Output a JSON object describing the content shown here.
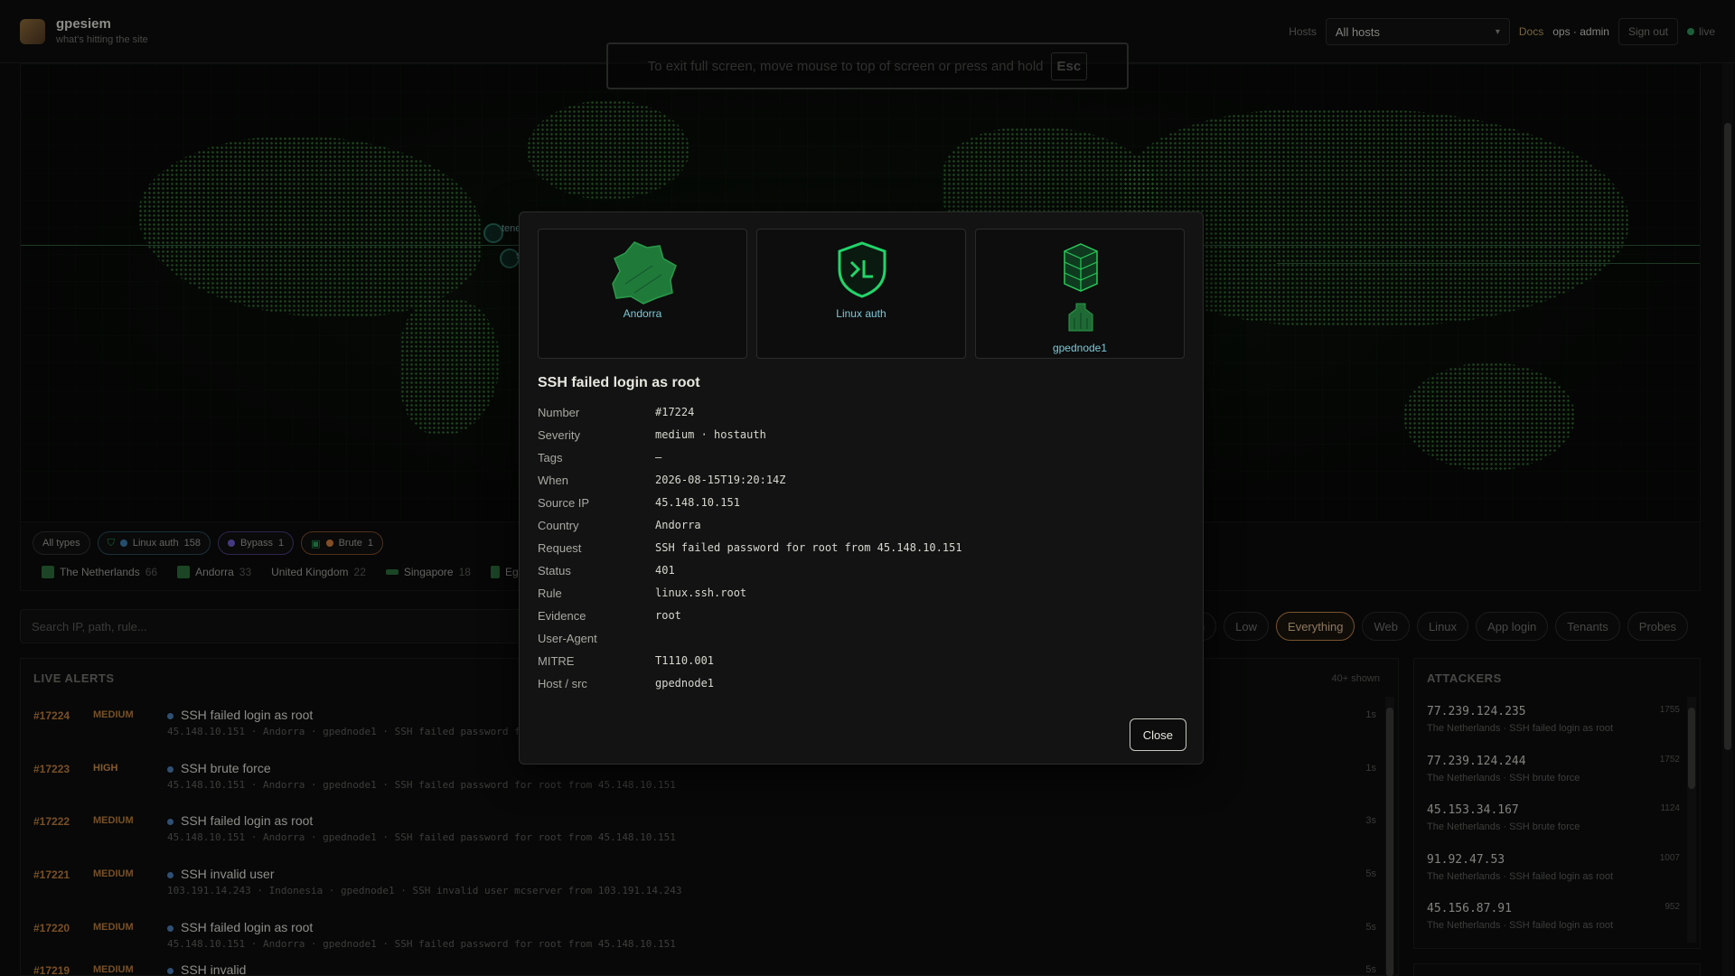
{
  "header": {
    "app_title": "gpesiem",
    "app_subtitle": "what's hitting the site",
    "hosts_label": "Hosts",
    "hosts_selected": "All hosts",
    "docs_link": "Docs",
    "user": "ops · admin",
    "signout_label": "Sign out",
    "live_label": "live"
  },
  "fullscreen_toast": {
    "text": "To exit full screen, move mouse to top of screen or press and hold",
    "key": "Esc"
  },
  "map": {
    "markers": [
      {
        "label": "tene"
      },
      {
        "label": "s"
      }
    ]
  },
  "type_chips": [
    {
      "label": "All types",
      "count": ""
    },
    {
      "label": "Linux auth",
      "count": "158",
      "color": "#3a78a8"
    },
    {
      "label": "Bypass",
      "count": "1",
      "color": "#6a58c8"
    },
    {
      "label": "Brute",
      "count": "1",
      "color": "#c8783a"
    }
  ],
  "countries": [
    {
      "name": "The Netherlands",
      "count": "66"
    },
    {
      "name": "Andorra",
      "count": "33"
    },
    {
      "name": "United Kingdom",
      "count": "22"
    },
    {
      "name": "Singapore",
      "count": "18"
    },
    {
      "name": "Egy",
      "count": ""
    }
  ],
  "search": {
    "placeholder": "Search IP, path, rule..."
  },
  "filters": [
    {
      "label": "edium",
      "active": false
    },
    {
      "label": "Low",
      "active": false
    },
    {
      "label": "Everything",
      "active": true
    },
    {
      "label": "Web",
      "active": false
    },
    {
      "label": "Linux",
      "active": false
    },
    {
      "label": "App login",
      "active": false
    },
    {
      "label": "Tenants",
      "active": false
    },
    {
      "label": "Probes",
      "active": false
    }
  ],
  "alerts": {
    "title": "LIVE ALERTS",
    "count_label": "40+ shown",
    "rows": [
      {
        "id": "#17224",
        "severity": "MEDIUM",
        "title": "SSH failed login as root",
        "meta": "45.148.10.151 · Andorra · gpednode1 · SSH failed password for root from 45.148.10.151",
        "time": "1s"
      },
      {
        "id": "#17223",
        "severity": "HIGH",
        "title": "SSH brute force",
        "meta": "45.148.10.151 · Andorra · gpednode1 · SSH failed password for root from 45.148.10.151",
        "time": "1s"
      },
      {
        "id": "#17222",
        "severity": "MEDIUM",
        "title": "SSH failed login as root",
        "meta": "45.148.10.151 · Andorra · gpednode1 · SSH failed password for root from 45.148.10.151",
        "time": "3s"
      },
      {
        "id": "#17221",
        "severity": "MEDIUM",
        "title": "SSH invalid user",
        "meta": "103.191.14.243 · Indonesia · gpednode1 · SSH invalid user mcserver from 103.191.14.243",
        "time": "5s"
      },
      {
        "id": "#17220",
        "severity": "MEDIUM",
        "title": "SSH failed login as root",
        "meta": "45.148.10.151 · Andorra · gpednode1 · SSH failed password for root from 45.148.10.151",
        "time": "5s"
      },
      {
        "id": "#17219",
        "severity": "MEDIUM",
        "title": "SSH invalid",
        "meta": "",
        "time": "5s"
      }
    ]
  },
  "attackers": {
    "title": "ATTACKERS",
    "rows": [
      {
        "ip": "77.239.124.235",
        "count": "1755",
        "desc": "The Netherlands · SSH failed login as root"
      },
      {
        "ip": "77.239.124.244",
        "count": "1752",
        "desc": "The Netherlands · SSH brute force"
      },
      {
        "ip": "45.153.34.167",
        "count": "1124",
        "desc": "The Netherlands · SSH brute force"
      },
      {
        "ip": "91.92.47.53",
        "count": "1007",
        "desc": "The Netherlands · SSH failed login as root"
      },
      {
        "ip": "45.156.87.91",
        "count": "952",
        "desc": "The Netherlands · SSH failed login as root"
      }
    ]
  },
  "modal": {
    "cards": [
      {
        "label": "Andorra",
        "icon": "andorra-map-icon"
      },
      {
        "label": "Linux auth",
        "icon": "linux-shield-icon"
      },
      {
        "label": "gpednode1",
        "icon": "server-stack-icon"
      }
    ],
    "title": "SSH failed login as root",
    "fields": [
      {
        "key": "Number",
        "value": "#17224"
      },
      {
        "key": "Severity",
        "value": "medium · hostauth"
      },
      {
        "key": "Tags",
        "value": "—"
      },
      {
        "key": "When",
        "value": "2026-08-15T19:20:14Z"
      },
      {
        "key": "Source IP",
        "value": "45.148.10.151"
      },
      {
        "key": "Country",
        "value": "Andorra"
      },
      {
        "key": "Request",
        "value": "SSH failed password for root from 45.148.10.151"
      },
      {
        "key": "Status",
        "value": "401"
      },
      {
        "key": "Rule",
        "value": "linux.ssh.root"
      },
      {
        "key": "Evidence",
        "value": "root"
      },
      {
        "key": "User-Agent",
        "value": ""
      },
      {
        "key": "MITRE",
        "value": "T1110.001"
      },
      {
        "key": "Host / src",
        "value": "gpednode1"
      }
    ],
    "close_label": "Close"
  },
  "colors": {
    "accent": "#b8804a",
    "map_green": "#3c8a3a",
    "link_cyan": "#7fc8d8"
  }
}
